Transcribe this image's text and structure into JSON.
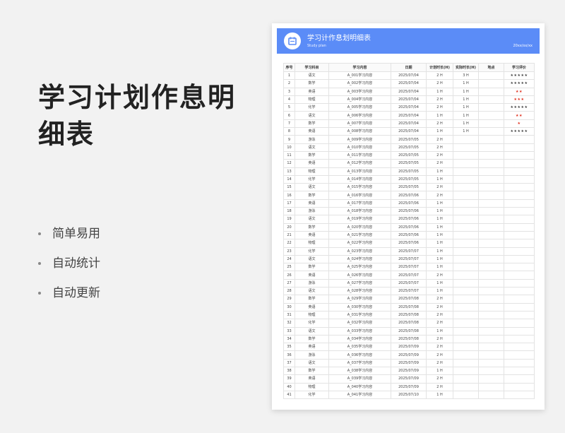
{
  "promo": {
    "title": "学习计划作息明细表",
    "features": [
      "简单易用",
      "自动统计",
      "自动更新"
    ]
  },
  "sheet": {
    "title": "学习计作息划明细表",
    "subtitle": "Study plan",
    "date": "20xx/xx/xx",
    "columns": [
      "序号",
      "学习科目",
      "学习内容",
      "日期",
      "计划时长(H)",
      "实际时长(H)",
      "地点",
      "学习评价"
    ],
    "rows": [
      [
        "1",
        "语文",
        "A_001学习内容",
        "2025/07/04",
        "2 H",
        "3 H",
        "",
        "★★★★★"
      ],
      [
        "2",
        "数学",
        "A_002学习内容",
        "2025/07/04",
        "2 H",
        "1 H",
        "",
        "★★★★★"
      ],
      [
        "3",
        "英语",
        "A_003学习内容",
        "2025/07/04",
        "1 H",
        "1 H",
        "",
        "★★"
      ],
      [
        "4",
        "物理",
        "A_004学习内容",
        "2025/07/04",
        "2 H",
        "1 H",
        "",
        "★★★"
      ],
      [
        "5",
        "化学",
        "A_005学习内容",
        "2025/07/04",
        "2 H",
        "1 H",
        "",
        "★★★★★"
      ],
      [
        "6",
        "语文",
        "A_006学习内容",
        "2025/07/04",
        "1 H",
        "1 H",
        "",
        "★★"
      ],
      [
        "7",
        "数学",
        "A_007学习内容",
        "2025/07/04",
        "2 H",
        "1 H",
        "",
        "★"
      ],
      [
        "8",
        "英语",
        "A_008学习内容",
        "2025/07/04",
        "1 H",
        "1 H",
        "",
        "★★★★★"
      ],
      [
        "9",
        "游泳",
        "A_009学习内容",
        "2025/07/05",
        "2 H",
        "",
        "",
        ""
      ],
      [
        "10",
        "语文",
        "A_010学习内容",
        "2025/07/05",
        "2 H",
        "",
        "",
        ""
      ],
      [
        "11",
        "数学",
        "A_011学习内容",
        "2025/07/05",
        "2 H",
        "",
        "",
        ""
      ],
      [
        "12",
        "英语",
        "A_012学习内容",
        "2025/07/05",
        "2 H",
        "",
        "",
        ""
      ],
      [
        "13",
        "物理",
        "A_013学习内容",
        "2025/07/05",
        "1 H",
        "",
        "",
        ""
      ],
      [
        "14",
        "化学",
        "A_014学习内容",
        "2025/07/05",
        "1 H",
        "",
        "",
        ""
      ],
      [
        "15",
        "语文",
        "A_015学习内容",
        "2025/07/05",
        "2 H",
        "",
        "",
        ""
      ],
      [
        "16",
        "数学",
        "A_016学习内容",
        "2025/07/06",
        "2 H",
        "",
        "",
        ""
      ],
      [
        "17",
        "英语",
        "A_017学习内容",
        "2025/07/06",
        "1 H",
        "",
        "",
        ""
      ],
      [
        "18",
        "游泳",
        "A_018学习内容",
        "2025/07/06",
        "1 H",
        "",
        "",
        ""
      ],
      [
        "19",
        "语文",
        "A_019学习内容",
        "2025/07/06",
        "1 H",
        "",
        "",
        ""
      ],
      [
        "20",
        "数学",
        "A_020学习内容",
        "2025/07/06",
        "1 H",
        "",
        "",
        ""
      ],
      [
        "21",
        "英语",
        "A_021学习内容",
        "2025/07/06",
        "1 H",
        "",
        "",
        ""
      ],
      [
        "22",
        "物理",
        "A_022学习内容",
        "2025/07/06",
        "1 H",
        "",
        "",
        ""
      ],
      [
        "23",
        "化学",
        "A_023学习内容",
        "2025/07/07",
        "1 H",
        "",
        "",
        ""
      ],
      [
        "24",
        "语文",
        "A_024学习内容",
        "2025/07/07",
        "1 H",
        "",
        "",
        ""
      ],
      [
        "25",
        "数学",
        "A_025学习内容",
        "2025/07/07",
        "1 H",
        "",
        "",
        ""
      ],
      [
        "26",
        "英语",
        "A_026学习内容",
        "2025/07/07",
        "2 H",
        "",
        "",
        ""
      ],
      [
        "27",
        "游泳",
        "A_027学习内容",
        "2025/07/07",
        "1 H",
        "",
        "",
        ""
      ],
      [
        "28",
        "语文",
        "A_028学习内容",
        "2025/07/07",
        "1 H",
        "",
        "",
        ""
      ],
      [
        "29",
        "数学",
        "A_029学习内容",
        "2025/07/08",
        "2 H",
        "",
        "",
        ""
      ],
      [
        "30",
        "英语",
        "A_030学习内容",
        "2025/07/08",
        "2 H",
        "",
        "",
        ""
      ],
      [
        "31",
        "物理",
        "A_031学习内容",
        "2025/07/08",
        "2 H",
        "",
        "",
        ""
      ],
      [
        "32",
        "化学",
        "A_032学习内容",
        "2025/07/08",
        "2 H",
        "",
        "",
        ""
      ],
      [
        "33",
        "语文",
        "A_033学习内容",
        "2025/07/08",
        "1 H",
        "",
        "",
        ""
      ],
      [
        "34",
        "数学",
        "A_034学习内容",
        "2025/07/08",
        "2 H",
        "",
        "",
        ""
      ],
      [
        "35",
        "英语",
        "A_035学习内容",
        "2025/07/09",
        "2 H",
        "",
        "",
        ""
      ],
      [
        "36",
        "游泳",
        "A_036学习内容",
        "2025/07/09",
        "2 H",
        "",
        "",
        ""
      ],
      [
        "37",
        "语文",
        "A_037学习内容",
        "2025/07/09",
        "2 H",
        "",
        "",
        ""
      ],
      [
        "38",
        "数学",
        "A_038学习内容",
        "2025/07/09",
        "1 H",
        "",
        "",
        ""
      ],
      [
        "39",
        "英语",
        "A_039学习内容",
        "2025/07/09",
        "2 H",
        "",
        "",
        ""
      ],
      [
        "40",
        "物理",
        "A_040学习内容",
        "2025/07/09",
        "2 H",
        "",
        "",
        ""
      ],
      [
        "41",
        "化学",
        "A_041学习内容",
        "2025/07/10",
        "1 H",
        "",
        "",
        ""
      ]
    ]
  },
  "colors": {
    "header_blue": "#5b8cf7",
    "star_blue": "#5b8cf7",
    "star_red": "#e0301e"
  }
}
